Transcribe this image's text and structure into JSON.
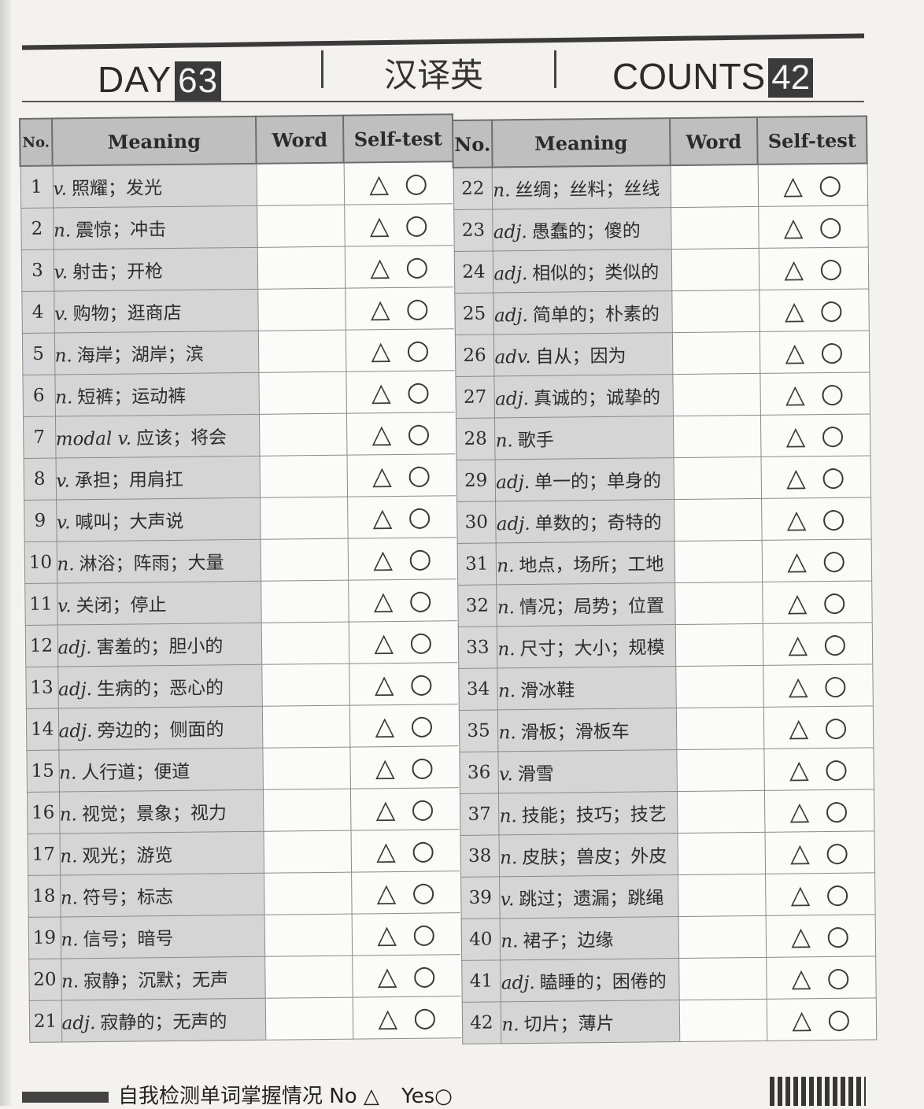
{
  "header": {
    "day_label": "DAY",
    "day_number": "63",
    "title": "汉译英",
    "counts_label": "COUNTS",
    "counts_number": "42"
  },
  "columns": {
    "no": "No.",
    "meaning": "Meaning",
    "word": "Word",
    "self_test": "Self-test"
  },
  "self_test_symbols": {
    "no": "△",
    "yes": "○"
  },
  "rows": [
    {
      "no": "1",
      "pos": "v.",
      "meaning": "照耀；发光"
    },
    {
      "no": "2",
      "pos": "n.",
      "meaning": "震惊；冲击"
    },
    {
      "no": "3",
      "pos": "v.",
      "meaning": "射击；开枪"
    },
    {
      "no": "4",
      "pos": "v.",
      "meaning": "购物；逛商店"
    },
    {
      "no": "5",
      "pos": "n.",
      "meaning": "海岸；湖岸；滨"
    },
    {
      "no": "6",
      "pos": "n.",
      "meaning": "短裤；运动裤"
    },
    {
      "no": "7",
      "pos": "modal v.",
      "meaning": "应该；将会"
    },
    {
      "no": "8",
      "pos": "v.",
      "meaning": "承担；用肩扛"
    },
    {
      "no": "9",
      "pos": "v.",
      "meaning": "喊叫；大声说"
    },
    {
      "no": "10",
      "pos": "n.",
      "meaning": "淋浴；阵雨；大量"
    },
    {
      "no": "11",
      "pos": "v.",
      "meaning": "关闭；停止"
    },
    {
      "no": "12",
      "pos": "adj.",
      "meaning": "害羞的；胆小的"
    },
    {
      "no": "13",
      "pos": "adj.",
      "meaning": "生病的；恶心的"
    },
    {
      "no": "14",
      "pos": "adj.",
      "meaning": "旁边的；侧面的"
    },
    {
      "no": "15",
      "pos": "n.",
      "meaning": "人行道；便道"
    },
    {
      "no": "16",
      "pos": "n.",
      "meaning": "视觉；景象；视力"
    },
    {
      "no": "17",
      "pos": "n.",
      "meaning": "观光；游览"
    },
    {
      "no": "18",
      "pos": "n.",
      "meaning": "符号；标志"
    },
    {
      "no": "19",
      "pos": "n.",
      "meaning": "信号；暗号"
    },
    {
      "no": "20",
      "pos": "n.",
      "meaning": "寂静；沉默；无声"
    },
    {
      "no": "21",
      "pos": "adj.",
      "meaning": "寂静的；无声的"
    },
    {
      "no": "22",
      "pos": "n.",
      "meaning": "丝绸；丝料；丝线"
    },
    {
      "no": "23",
      "pos": "adj.",
      "meaning": "愚蠢的；傻的"
    },
    {
      "no": "24",
      "pos": "adj.",
      "meaning": "相似的；类似的"
    },
    {
      "no": "25",
      "pos": "adj.",
      "meaning": "简单的；朴素的"
    },
    {
      "no": "26",
      "pos": "adv.",
      "meaning": "自从；因为"
    },
    {
      "no": "27",
      "pos": "adj.",
      "meaning": "真诚的；诚挚的"
    },
    {
      "no": "28",
      "pos": "n.",
      "meaning": "歌手"
    },
    {
      "no": "29",
      "pos": "adj.",
      "meaning": "单一的；单身的"
    },
    {
      "no": "30",
      "pos": "adj.",
      "meaning": "单数的；奇特的"
    },
    {
      "no": "31",
      "pos": "n.",
      "meaning": "地点，场所；工地"
    },
    {
      "no": "32",
      "pos": "n.",
      "meaning": "情况；局势；位置"
    },
    {
      "no": "33",
      "pos": "n.",
      "meaning": "尺寸；大小；规模"
    },
    {
      "no": "34",
      "pos": "n.",
      "meaning": "滑冰鞋"
    },
    {
      "no": "35",
      "pos": "n.",
      "meaning": "滑板；滑板车"
    },
    {
      "no": "36",
      "pos": "v.",
      "meaning": "滑雪"
    },
    {
      "no": "37",
      "pos": "n.",
      "meaning": "技能；技巧；技艺"
    },
    {
      "no": "38",
      "pos": "n.",
      "meaning": "皮肤；兽皮；外皮"
    },
    {
      "no": "39",
      "pos": "v.",
      "meaning": "跳过；遗漏；跳绳"
    },
    {
      "no": "40",
      "pos": "n.",
      "meaning": "裙子；边缘"
    },
    {
      "no": "41",
      "pos": "adj.",
      "meaning": "瞌睡的；困倦的"
    },
    {
      "no": "42",
      "pos": "n.",
      "meaning": "切片；薄片"
    }
  ],
  "footer": {
    "text": "自我检测单词掌握情况 No",
    "no_symbol": "△",
    "yes_label": "Yes",
    "yes_symbol": "○"
  }
}
